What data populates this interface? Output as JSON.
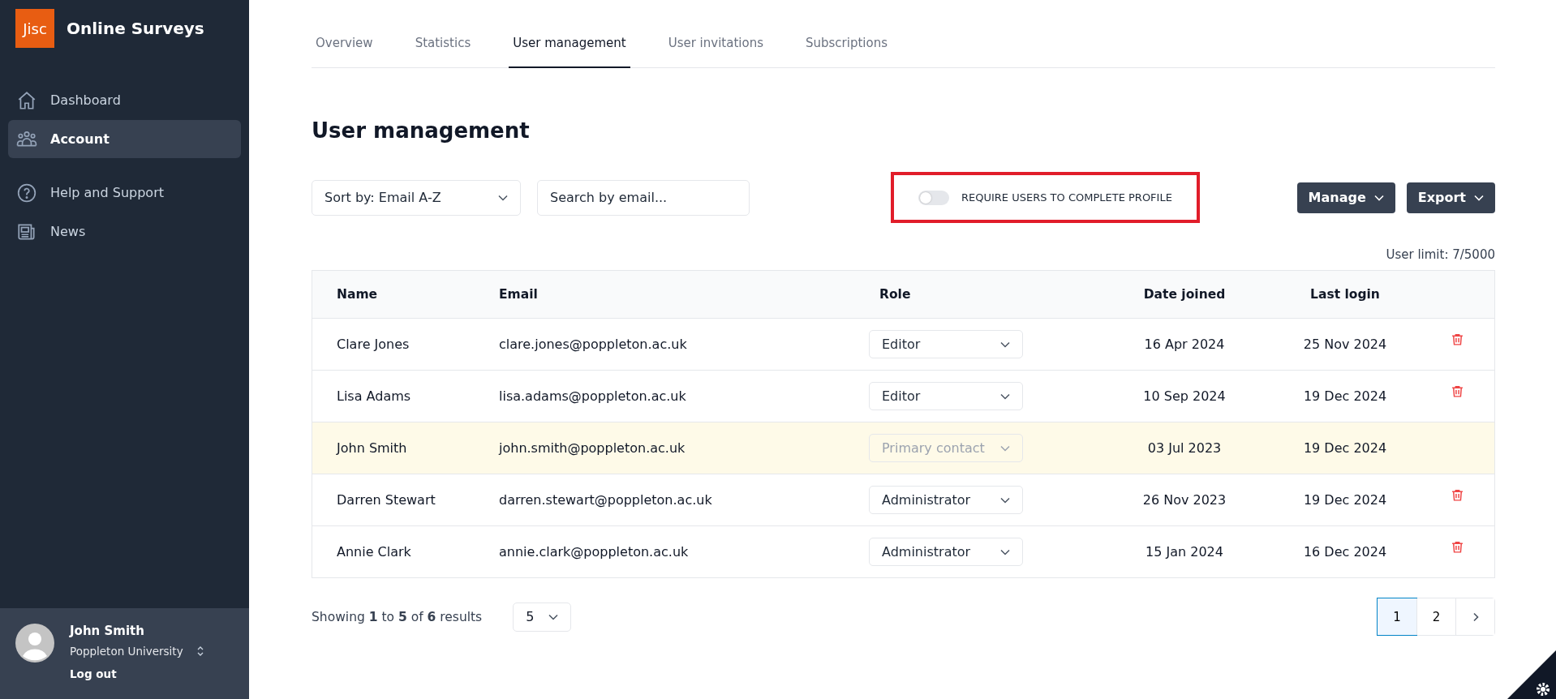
{
  "sidebar": {
    "logo": "Jisc",
    "app_name": "Online Surveys",
    "items": [
      {
        "label": "Dashboard",
        "selected": false
      },
      {
        "label": "Account",
        "selected": true
      },
      {
        "label": "Help and Support",
        "selected": false
      },
      {
        "label": "News",
        "selected": false
      }
    ],
    "user": {
      "name": "John Smith",
      "organisation": "Poppleton University",
      "logout": "Log out"
    }
  },
  "tabs": [
    {
      "label": "Overview",
      "selected": false
    },
    {
      "label": "Statistics",
      "selected": false
    },
    {
      "label": "User management",
      "selected": true
    },
    {
      "label": "User invitations",
      "selected": false
    },
    {
      "label": "Subscriptions",
      "selected": false
    }
  ],
  "heading": "User management",
  "sort": {
    "value": "Sort by: Email A-Z"
  },
  "search": {
    "placeholder": "Search by email..."
  },
  "require_profile": {
    "label": "REQUIRE USERS TO COMPLETE PROFILE",
    "on": false,
    "highlighted": true
  },
  "buttons": [
    "Manage",
    "Export"
  ],
  "user_limit": "User limit: 7/5000",
  "table": {
    "columns": [
      "Name",
      "Email",
      "Role",
      "Date joined",
      "Last login"
    ],
    "rows": [
      {
        "name": "Clare Jones",
        "email": "clare.jones@poppleton.ac.uk",
        "role": "Editor",
        "role_disabled": false,
        "joined": "16 Apr 2024",
        "last_login": "25 Nov 2024",
        "highlighted": false,
        "deletable": true
      },
      {
        "name": "Lisa Adams",
        "email": "lisa.adams@poppleton.ac.uk",
        "role": "Editor",
        "role_disabled": false,
        "joined": "10 Sep 2024",
        "last_login": "19 Dec 2024",
        "highlighted": false,
        "deletable": true
      },
      {
        "name": "John Smith",
        "email": "john.smith@poppleton.ac.uk",
        "role": "Primary contact",
        "role_disabled": true,
        "joined": "03 Jul 2023",
        "last_login": "19 Dec 2024",
        "highlighted": true,
        "deletable": false
      },
      {
        "name": "Darren Stewart",
        "email": "darren.stewart@poppleton.ac.uk",
        "role": "Administrator",
        "role_disabled": false,
        "joined": "26 Nov 2023",
        "last_login": "19 Dec 2024",
        "highlighted": false,
        "deletable": true
      },
      {
        "name": "Annie Clark",
        "email": "annie.clark@poppleton.ac.uk",
        "role": "Administrator",
        "role_disabled": false,
        "joined": "15 Jan 2024",
        "last_login": "16 Dec 2024",
        "highlighted": false,
        "deletable": true
      }
    ]
  },
  "footer": {
    "summary": "Showing **1** to **5** of **6** results",
    "page_size": "5",
    "pages": [
      {
        "label": "1",
        "selected": true
      },
      {
        "label": "2",
        "selected": false
      }
    ]
  }
}
